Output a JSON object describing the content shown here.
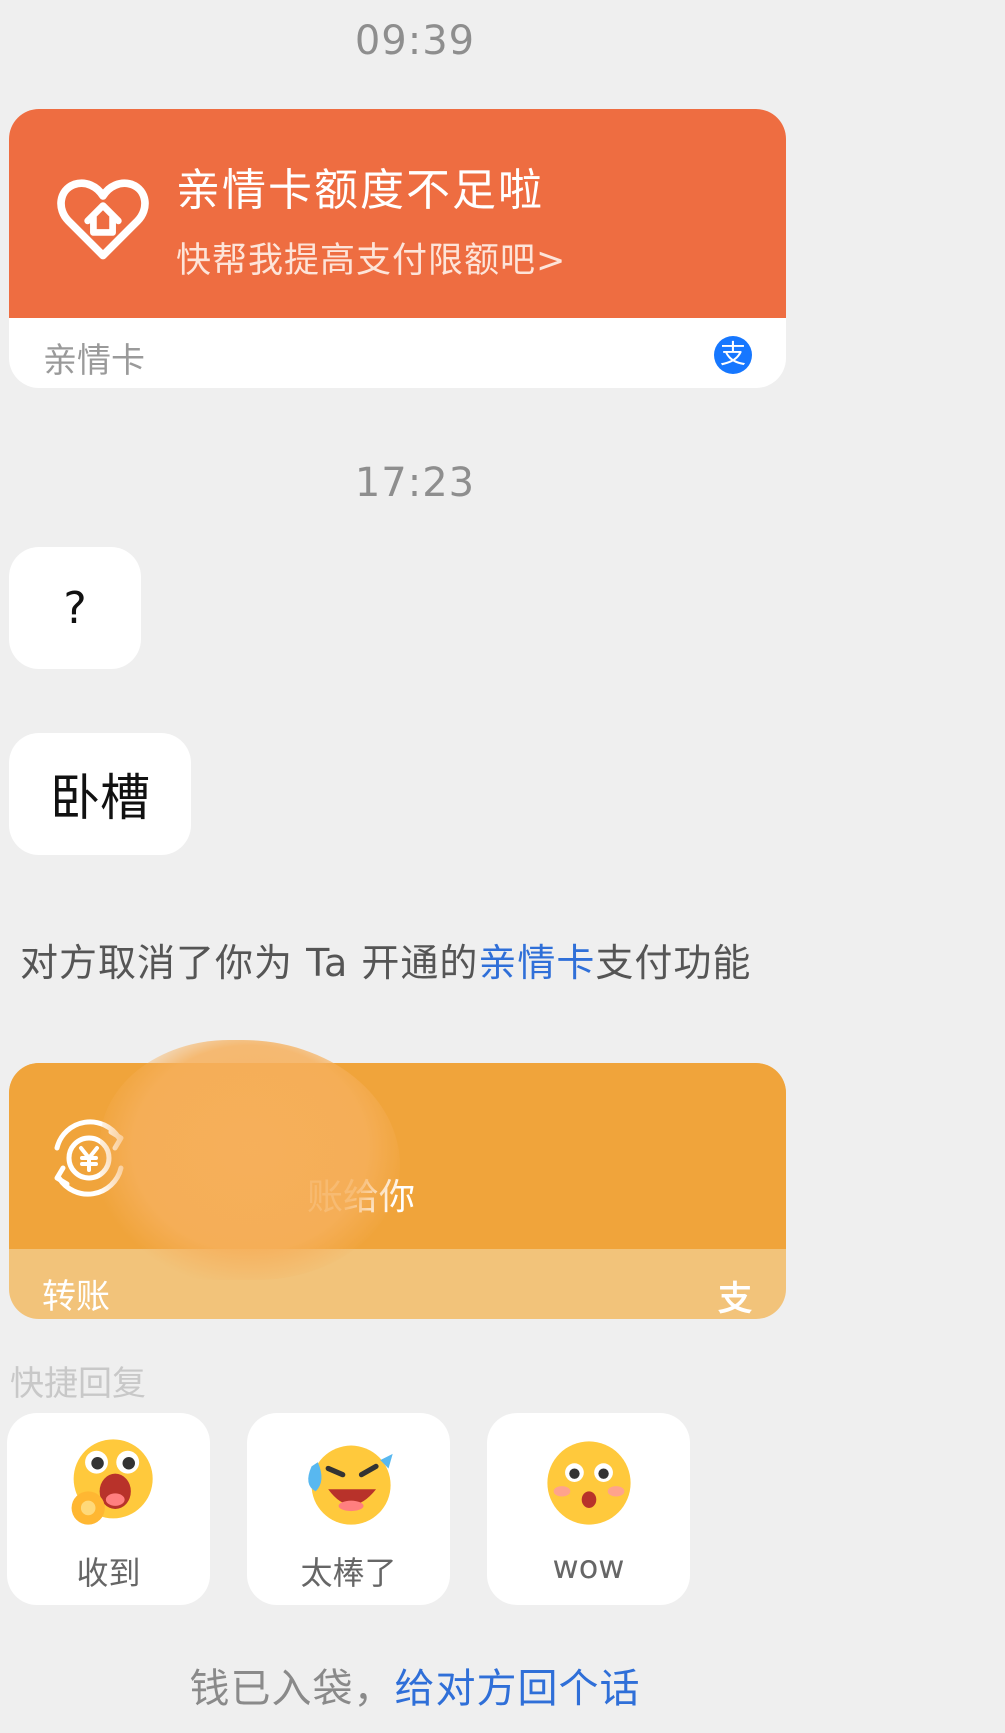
{
  "timestamps": [
    "09:39",
    "17:23"
  ],
  "family_card": {
    "title": "亲情卡额度不足啦",
    "subtitle": "快帮我提高支付限额吧>",
    "footer_label": "亲情卡",
    "badge": "支",
    "icon": "heart-house-icon",
    "color": "#ee6d41"
  },
  "messages": [
    "?",
    "卧槽"
  ],
  "system_notice": {
    "prefix": "对方取消了你为 Ta 开通的",
    "link": "亲情卡",
    "suffix": "支付功能"
  },
  "transfer_card": {
    "text": "账给你",
    "footer_label": "转账",
    "badge": "支",
    "icon": "yuan-transfer-icon",
    "color": "#f0a43b"
  },
  "quick_reply": {
    "label": "快捷回复",
    "items": [
      {
        "caption": "收到",
        "icon": "ok-hand-emoji-icon"
      },
      {
        "caption": "太棒了",
        "icon": "laughing-crying-emoji-icon"
      },
      {
        "caption": "wow",
        "icon": "surprised-emoji-icon"
      }
    ]
  },
  "footer": {
    "prefix": "钱已入袋，",
    "link": "给对方回个话"
  }
}
